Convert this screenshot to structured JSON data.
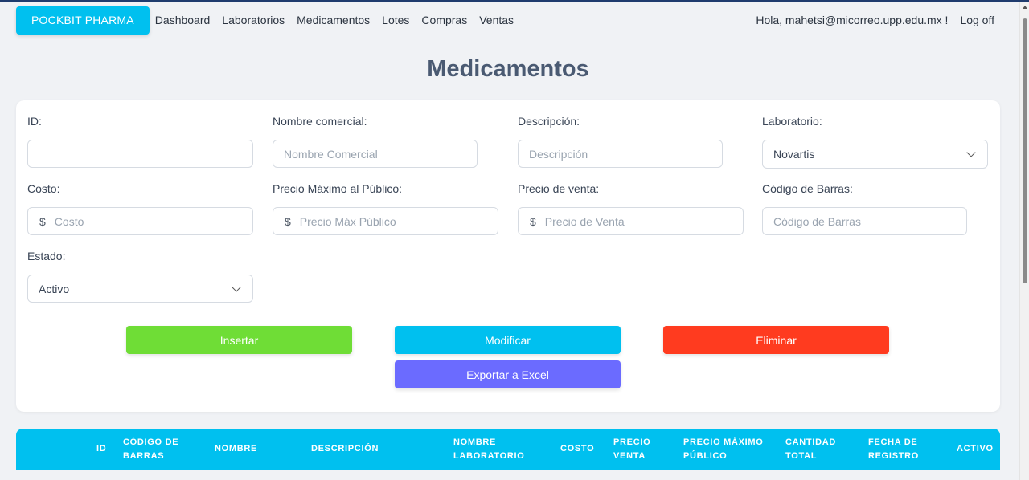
{
  "navbar": {
    "brand": "POCKBIT PHARMA",
    "links": [
      "Dashboard",
      "Laboratorios",
      "Medicamentos",
      "Lotes",
      "Compras",
      "Ventas"
    ],
    "greeting": "Hola, mahetsi@micorreo.upp.edu.mx !",
    "logoff": "Log off"
  },
  "page": {
    "title": "Medicamentos"
  },
  "form": {
    "id": {
      "label": "ID:",
      "value": ""
    },
    "nombre": {
      "label": "Nombre comercial:",
      "placeholder": "Nombre Comercial"
    },
    "descripcion": {
      "label": "Descripción:",
      "placeholder": "Descripción"
    },
    "laboratorio": {
      "label": "Laboratorio:",
      "selected": "Novartis"
    },
    "costo": {
      "label": "Costo:",
      "prefix": "$",
      "placeholder": "Costo"
    },
    "precio_max": {
      "label": "Precio Máximo al Público:",
      "prefix": "$",
      "placeholder": "Precio Máx Público"
    },
    "precio_venta": {
      "label": "Precio de venta:",
      "prefix": "$",
      "placeholder": "Precio de Venta"
    },
    "codigo": {
      "label": "Código de Barras:",
      "placeholder": "Código de Barras"
    },
    "estado": {
      "label": "Estado:",
      "selected": "Activo"
    }
  },
  "buttons": {
    "insertar": "Insertar",
    "modificar": "Modificar",
    "eliminar": "Eliminar",
    "exportar": "Exportar a Excel"
  },
  "colors": {
    "brand": "#00c0ef",
    "insertar": "#6fdd36",
    "modificar": "#00c0ef",
    "eliminar": "#ff3b1f",
    "exportar": "#6b6bff",
    "table_header": "#00c0ef"
  },
  "table": {
    "headers": [
      [
        "ID"
      ],
      [
        "CÓDIGO DE",
        "BARRAS"
      ],
      [
        "NOMBRE"
      ],
      [
        "DESCRIPCIÓN"
      ],
      [
        "NOMBRE",
        "LABORATORIO"
      ],
      [
        "COSTO"
      ],
      [
        "PRECIO",
        "VENTA"
      ],
      [
        "PRECIO MÁXIMO",
        "PÚBLICO"
      ],
      [
        "CANTIDAD",
        "TOTAL"
      ],
      [
        "FECHA DE",
        "REGISTRO"
      ],
      [
        "ACTIVO"
      ]
    ]
  }
}
